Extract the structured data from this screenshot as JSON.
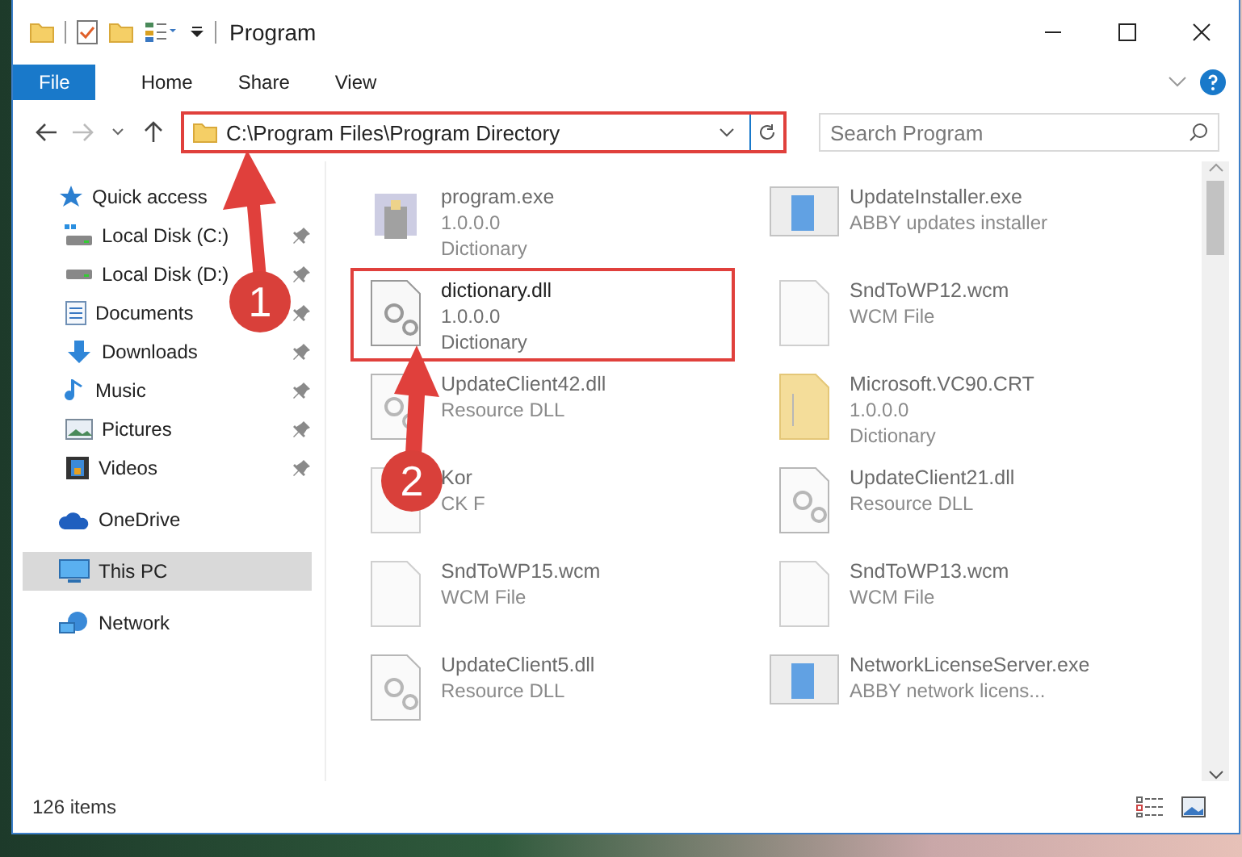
{
  "window": {
    "title": "Program"
  },
  "ribbon_tabs": [
    {
      "label": "File",
      "kind": "file"
    },
    {
      "label": "Home",
      "kind": "tab"
    },
    {
      "label": "Share",
      "kind": "tab"
    },
    {
      "label": "View",
      "kind": "tab"
    }
  ],
  "address_bar": {
    "path": "C:\\Program Files\\Program Directory",
    "highlighted": true
  },
  "search": {
    "placeholder": "Search Program"
  },
  "nav_pane": [
    {
      "label": "Quick access",
      "kind": "star",
      "selected": false,
      "children": [
        {
          "label": "Local Disk (C:)",
          "kind": "system-drive",
          "pinned": true,
          "selected": false
        },
        {
          "label": "Local Disk (D:)",
          "kind": "drive",
          "pinned": true,
          "selected": false
        },
        {
          "label": "Documents",
          "kind": "documents",
          "pinned": true,
          "selected": false
        },
        {
          "label": "Downloads",
          "kind": "downloads",
          "pinned": true,
          "selected": false
        },
        {
          "label": "Music",
          "kind": "music",
          "pinned": true,
          "selected": false
        },
        {
          "label": "Pictures",
          "kind": "pictures",
          "pinned": true,
          "selected": false
        },
        {
          "label": "Videos",
          "kind": "videos",
          "pinned": true,
          "selected": false
        }
      ]
    },
    {
      "label": "OneDrive",
      "kind": "cloud",
      "selected": false
    },
    {
      "label": "This PC",
      "kind": "pc",
      "selected": true
    },
    {
      "label": "Network",
      "kind": "network",
      "selected": false
    }
  ],
  "files": [
    {
      "name": "program.exe",
      "details": [
        "1.0.0.0",
        "Dictionary"
      ],
      "kind": "app",
      "blurred": true,
      "highlighted": false
    },
    {
      "name": "UpdateInstaller.exe",
      "details": [
        "ABBY updates installer"
      ],
      "kind": "installer",
      "blurred": true,
      "highlighted": false
    },
    {
      "name": "dictionary.dll",
      "details": [
        "1.0.0.0",
        "Dictionary"
      ],
      "kind": "dll",
      "blurred": false,
      "highlighted": true
    },
    {
      "name": "SndToWP12.wcm",
      "details": [
        "WCM File"
      ],
      "kind": "blank",
      "blurred": true,
      "highlighted": false
    },
    {
      "name": "UpdateClient42.dll",
      "details": [
        "Resource DLL"
      ],
      "kind": "dll",
      "blurred": true,
      "highlighted": false
    },
    {
      "name": "Microsoft.VC90.CRT",
      "details": [
        "1.0.0.0",
        "Dictionary"
      ],
      "kind": "manifest",
      "blurred": true,
      "highlighted": false
    },
    {
      "name": "Kor",
      "details": [
        "CK F"
      ],
      "kind": "blank",
      "blurred": true,
      "highlighted": false
    },
    {
      "name": "UpdateClient21.dll",
      "details": [
        "Resource DLL"
      ],
      "kind": "dll",
      "blurred": true,
      "highlighted": false
    },
    {
      "name": "SndToWP15.wcm",
      "details": [
        "WCM File"
      ],
      "kind": "blank",
      "blurred": true,
      "highlighted": false
    },
    {
      "name": "SndToWP13.wcm",
      "details": [
        "WCM File"
      ],
      "kind": "blank",
      "blurred": true,
      "highlighted": false
    },
    {
      "name": "UpdateClient5.dll",
      "details": [
        "Resource DLL"
      ],
      "kind": "dll",
      "blurred": true,
      "highlighted": false
    },
    {
      "name": "NetworkLicenseServer.exe",
      "details": [
        "ABBY network licens..."
      ],
      "kind": "installer",
      "blurred": true,
      "highlighted": false
    }
  ],
  "status_bar": {
    "item_count": "126 items"
  },
  "callouts": [
    {
      "number": "1"
    },
    {
      "number": "2"
    }
  ]
}
